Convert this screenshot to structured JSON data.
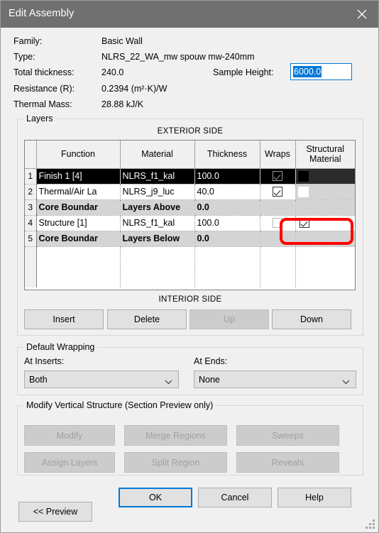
{
  "window": {
    "title": "Edit Assembly",
    "close_icon": "close-icon",
    "titlebar_color": "#707070",
    "accent_color": "#0078d7"
  },
  "info": {
    "family_label": "Family:",
    "family_value": "Basic Wall",
    "type_label": "Type:",
    "type_value": "NLRS_22_WA_mw spouw mw-240mm",
    "total_thickness_label": "Total thickness:",
    "total_thickness_value": "240.0",
    "resistance_label": "Resistance (R):",
    "resistance_value": "0.2394 (m²·K)/W",
    "thermal_mass_label": "Thermal Mass:",
    "thermal_mass_value": "28.88 kJ/K",
    "sample_height_label": "Sample Height:",
    "sample_height_value": "6000.0",
    "sample_height_selected": true
  },
  "layers": {
    "group_title": "Layers",
    "exterior_side": "EXTERIOR SIDE",
    "interior_side": "INTERIOR SIDE",
    "columns": [
      "",
      "Function",
      "Material",
      "Thickness",
      "Wraps",
      "Structural Material"
    ],
    "rows": [
      {
        "num": "1",
        "function": "Finish 1 [4]",
        "material": "NLRS_f1_kal",
        "thickness": "100.0",
        "wraps": "checked",
        "structural_material": "swatch-black",
        "style": "selected"
      },
      {
        "num": "2",
        "function": "Thermal/Air La",
        "material": "NLRS_j9_luc",
        "thickness": "40.0",
        "wraps": "checked",
        "structural_material": "swatch-white",
        "style": "plain"
      },
      {
        "num": "3",
        "function": "Core Boundar",
        "material": "Layers Above",
        "thickness": "0.0",
        "wraps": "",
        "structural_material": "",
        "style": "core"
      },
      {
        "num": "4",
        "function": "Structure [1]",
        "material": "NLRS_f1_kal",
        "thickness": "100.0",
        "wraps": "unchecked",
        "structural_material": "checked",
        "style": "plain"
      },
      {
        "num": "5",
        "function": "Core Boundar",
        "material": "Layers Below",
        "thickness": "0.0",
        "wraps": "",
        "structural_material": "",
        "style": "core"
      }
    ],
    "annotation_color": "#ff0000",
    "buttons": [
      {
        "label": "Insert",
        "enabled": true
      },
      {
        "label": "Delete",
        "enabled": true
      },
      {
        "label": "Up",
        "enabled": false
      },
      {
        "label": "Down",
        "enabled": true
      }
    ]
  },
  "default_wrapping": {
    "group_title": "Default Wrapping",
    "at_inserts_label": "At Inserts:",
    "at_inserts_value": "Both",
    "at_ends_label": "At  Ends:",
    "at_ends_value": "None"
  },
  "modify_vertical": {
    "group_title": "Modify Vertical Structure (Section Preview only)",
    "buttons": [
      {
        "label": "Modify",
        "enabled": false
      },
      {
        "label": "Merge Regions",
        "enabled": false
      },
      {
        "label": "Sweeps",
        "enabled": false
      },
      {
        "label": "Assign Layers",
        "enabled": false
      },
      {
        "label": "Split Region",
        "enabled": false
      },
      {
        "label": "Reveals",
        "enabled": false
      }
    ]
  },
  "footer": {
    "preview_label": "<< Preview",
    "ok_label": "OK",
    "cancel_label": "Cancel",
    "help_label": "Help",
    "ok_focused": true
  }
}
